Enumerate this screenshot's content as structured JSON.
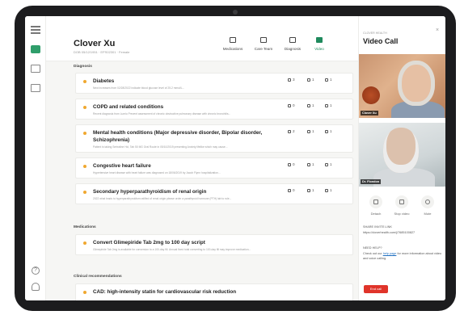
{
  "patient": {
    "name": "Clover Xu",
    "meta": "DOB 05/12/1951 · EPS02301 · Female"
  },
  "nav": [
    {
      "label": "Medications",
      "icon": "pill-icon"
    },
    {
      "label": "Care Team",
      "icon": "team-icon"
    },
    {
      "label": "Diagnosis",
      "icon": "clipboard-icon"
    },
    {
      "label": "Video",
      "icon": "video-icon",
      "active": true
    }
  ],
  "sections": {
    "diagnosis": "Diagnosis",
    "medications": "Medications",
    "clinical": "Clinical recommendations"
  },
  "diagnosis_cards": [
    {
      "title": "Diabetes",
      "desc": "New increases from 02/28/2022 indicate blood glucose level of 25.2 mmol/L...",
      "m1": "3",
      "m2": "1",
      "m3": "1"
    },
    {
      "title": "COPD and related conditions",
      "desc": "Recent diagnosis from Lumio Prevent assessment of chronic obstructive pulmonary disease with chronic bronchitis...",
      "m1": "0",
      "m2": "1",
      "m3": "1"
    },
    {
      "title": "Mental health conditions (Major depressive disorder, Bipolar disorder, Schizophrenia)",
      "desc": "Patient is taking Sertraline Hcl, Tab 50 MG Oral Route in 05/10/2019 presenting Anxiety lifelike which may cause...",
      "m1": "2",
      "m2": "1",
      "m3": "1"
    },
    {
      "title": "Congestive heart failure",
      "desc": "Hypertensive heart disease with heart failure was diagnosed on 18/06/2019 by Jacob Flynn hospitalization...",
      "m1": "0",
      "m2": "1",
      "m3": "1"
    },
    {
      "title": "Secondary hyperparathyroidism of renal origin",
      "desc": "2022 what leads to hyperparathyroidism ratified of renal origin please order a parathyroid hormone (PTH) lab to rule...",
      "m1": "0",
      "m2": "1",
      "m3": "1"
    }
  ],
  "medication_cards": [
    {
      "title": "Convert Glimepiride Tab 2mg to 100 day script",
      "desc": "Glimepiride Tab 2mg is available for conversion to a 100-day fill. Annual fixed total converting to 100-day fill may improve medication..."
    }
  ],
  "clinical_cards": [
    {
      "title": "CAD: high-intensity statin for cardiovascular risk reduction"
    }
  ],
  "call": {
    "eyebrow": "CLOVER HEALTH",
    "title": "Video Call",
    "close": "×",
    "tag1": "Clover Xu",
    "tag2": "Dr. Flondon",
    "controls": [
      {
        "label": "Detach",
        "icon": "detach-icon"
      },
      {
        "label": "Stop video",
        "icon": "camera-icon"
      },
      {
        "label": "Mute",
        "icon": "microphone-icon"
      }
    ],
    "share_label": "SHARE INVITE LINK",
    "share_url": "https://cloverhealth.com/j/7685100827",
    "help_label": "NEED HELP?",
    "help_pre": "Check out our",
    "help_link": "help page",
    "help_post": "for more information about video and voice calling.",
    "end_label": "End call"
  }
}
